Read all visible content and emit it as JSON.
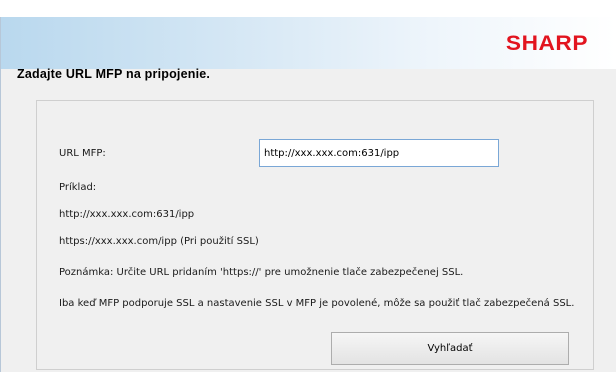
{
  "brand": {
    "logo_text": "SHARP",
    "logo_color": "#e2141f"
  },
  "page": {
    "heading": "Zadajte URL MFP na pripojenie."
  },
  "form": {
    "url_label": "URL MFP:",
    "url_value": "http://xxx.xxx.com:631/ipp",
    "example_label": "Príklad:",
    "example_1": "http://xxx.xxx.com:631/ipp",
    "example_2": "https://xxx.xxx.com/ipp (Pri použití SSL)",
    "note": "Poznámka: Určite URL pridaním 'https://' pre umožnenie tlače zabezpečenej SSL.",
    "info": "Iba keď MFP podporuje SSL a nastavenie SSL v MFP je povolené, môže sa použiť tlač zabezpečená SSL.",
    "search_button": "Vyhľadať"
  }
}
